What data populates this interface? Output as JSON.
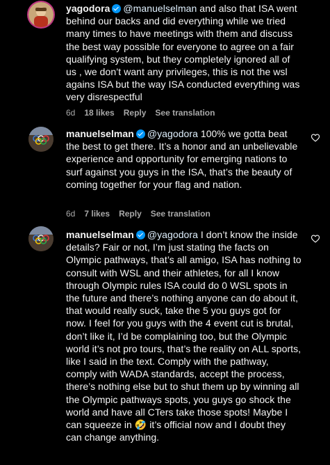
{
  "comments": [
    {
      "username": "yagodora",
      "mention": "@manuelselman",
      "text": " and also that ISA went behind our backs and did everything while we tried many times to have meetings with them and discuss the best way possible for everyone to agree on a fair qualifying system, but they completely ignored all of us , we don’t want any privileges, this is not the wsl agains ISA but the way ISA conducted everything was very disrespectful",
      "time": "6d",
      "likes": "18 likes",
      "reply": "Reply",
      "translate": "See translation"
    },
    {
      "username": "manuelselman",
      "mention": "@yagodora",
      "text": " 100% we gotta beat the best to get there. It’s a honor and an unbelievable experience and opportunity for emerging nations to surf against you guys in the ISA, that’s the beauty of coming together for your flag and nation.",
      "time": "6d",
      "likes": "7 likes",
      "reply": "Reply",
      "translate": "See translation"
    },
    {
      "username": "manuelselman",
      "mention": "@yagodora",
      "text_a": " I don’t know the inside details? Fair or not, I’m just stating the facts on Olympic pathways, that’s all amigo, ISA has nothing to consult with WSL and their athletes, for all I know through Olympic rules ISA could do 0 WSL spots in the future and there’s nothing anyone can do about it, that would really suck, take the 5 you guys got for now. I feel for you guys with the 4 event cut is brutal, don’t like it, I’d be complaining too, but the Olympic world it’s not pro tours, that’s the reality on ALL sports, like I said in the text. Comply with the pathway, comply with WADA standards, accept the process, there’s nothing else but to shut them up by winning all the Olympic pathways spots, you guys go shock the world and have all CTers take those spots! Maybe I can squeeze in ",
      "emoji": "🤣",
      "text_b": " it’s official now and I doubt they can change anything."
    }
  ],
  "icons": {
    "verified": "verified-badge-icon",
    "like": "heart-icon"
  },
  "colors": {
    "background": "#000000",
    "text": "#f5f5f5",
    "muted": "#a8a8a8",
    "verified": "#0095f6",
    "mention": "#e0f1ff"
  }
}
